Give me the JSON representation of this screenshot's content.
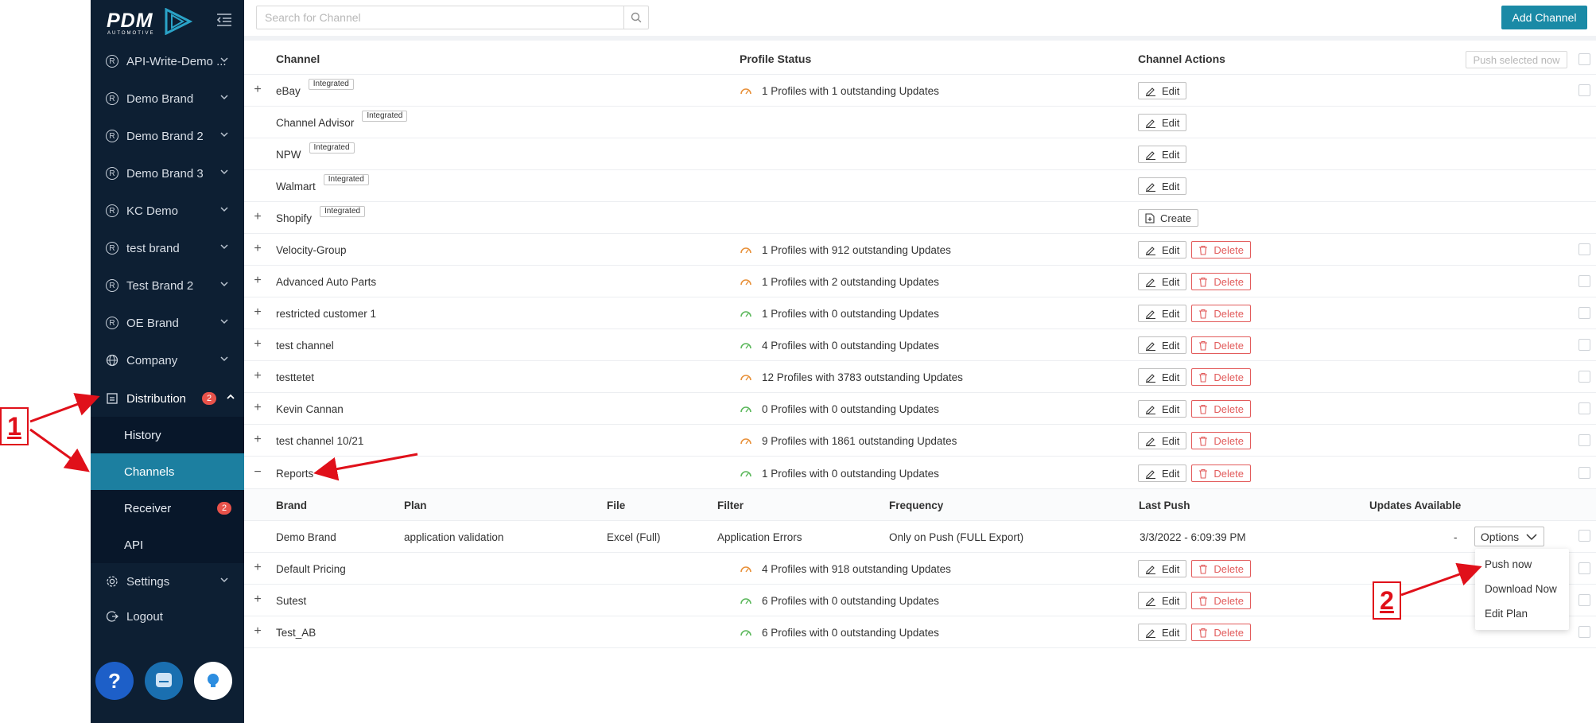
{
  "colors": {
    "sidebar_bg": "#0d1f33",
    "accent": "#1a8aa6",
    "danger": "#e25b5b",
    "gauge_orange": "#e8913a",
    "gauge_green": "#5cb85c",
    "annotation": "#e0101a"
  },
  "logo": {
    "text": "PDM",
    "subtext": "AUTOMOTIVE"
  },
  "sidebar": {
    "items": [
      {
        "label": "API-Write-Demo ...",
        "icon": "registered-icon"
      },
      {
        "label": "Demo Brand",
        "icon": "registered-icon"
      },
      {
        "label": "Demo Brand 2",
        "icon": "registered-icon"
      },
      {
        "label": "Demo Brand 3",
        "icon": "registered-icon"
      },
      {
        "label": "KC Demo",
        "icon": "registered-icon"
      },
      {
        "label": "test brand",
        "icon": "registered-icon"
      },
      {
        "label": "Test Brand 2",
        "icon": "registered-icon"
      },
      {
        "label": "OE Brand",
        "icon": "registered-icon"
      },
      {
        "label": "Company",
        "icon": "globe-icon"
      }
    ],
    "distribution": {
      "label": "Distribution",
      "badge": "2"
    },
    "sub_items": [
      {
        "label": "History"
      },
      {
        "label": "Channels"
      },
      {
        "label": "Receiver",
        "badge": "2"
      },
      {
        "label": "API"
      }
    ],
    "settings": {
      "label": "Settings"
    },
    "logout": {
      "label": "Logout"
    }
  },
  "search": {
    "placeholder": "Search for Channel",
    "value": ""
  },
  "add_channel": "Add Channel",
  "table": {
    "headers": {
      "channel": "Channel",
      "profile_status": "Profile Status",
      "channel_actions": "Channel Actions"
    },
    "push_selected": "Push selected now",
    "edit_label": "Edit",
    "delete_label": "Delete",
    "create_label": "Create",
    "tag_label": "Integrated",
    "rows": [
      {
        "name": "eBay",
        "tag": true,
        "status": "1 Profiles with 1 outstanding Updates",
        "gauge": "orange"
      },
      {
        "name": "Channel Advisor",
        "tag": true,
        "status": ""
      },
      {
        "name": "NPW",
        "tag": true,
        "status": ""
      },
      {
        "name": "Walmart",
        "tag": true,
        "status": ""
      },
      {
        "name": "Shopify",
        "tag": true,
        "status": ""
      },
      {
        "name": "Velocity-Group",
        "status": "1 Profiles with 912 outstanding Updates",
        "gauge": "orange"
      },
      {
        "name": "Advanced Auto Parts",
        "status": "1 Profiles with 2 outstanding Updates",
        "gauge": "orange"
      },
      {
        "name": "restricted customer 1",
        "status": "1 Profiles with 0 outstanding Updates",
        "gauge": "green"
      },
      {
        "name": "test channel",
        "status": "4 Profiles with 0 outstanding Updates",
        "gauge": "green"
      },
      {
        "name": "testtetet",
        "status": "12 Profiles with 3783 outstanding Updates",
        "gauge": "orange"
      },
      {
        "name": "Kevin Cannan",
        "status": "0 Profiles with 0 outstanding Updates",
        "gauge": "green"
      },
      {
        "name": "test channel 10/21",
        "status": "9 Profiles with 1861 outstanding Updates",
        "gauge": "orange"
      },
      {
        "name": "Reports",
        "status": "1 Profiles with 0 outstanding Updates",
        "gauge": "green"
      },
      {
        "name": "Default Pricing",
        "status": "4 Profiles with 918 outstanding Updates",
        "gauge": "orange"
      },
      {
        "name": "Sutest",
        "status": "6 Profiles with 0 outstanding Updates",
        "gauge": "green"
      },
      {
        "name": "Test_AB",
        "status": "6 Profiles with 0 outstanding Updates",
        "gauge": "green"
      }
    ],
    "sub_headers": {
      "brand": "Brand",
      "plan": "Plan",
      "file": "File",
      "filter": "Filter",
      "frequency": "Frequency",
      "last_push": "Last Push",
      "updates_available": "Updates Available"
    },
    "sub_row": {
      "brand": "Demo Brand",
      "plan": "application validation",
      "file": "Excel (Full)",
      "filter": "Application Errors",
      "frequency": "Only on Push (FULL Export)",
      "last_push": "3/3/2022 - 6:09:39 PM",
      "updates": "-",
      "options": "Options"
    }
  },
  "options_menu": [
    "Push now",
    "Download Now",
    "Edit Plan"
  ],
  "annotations": {
    "one": "1",
    "two": "2"
  }
}
